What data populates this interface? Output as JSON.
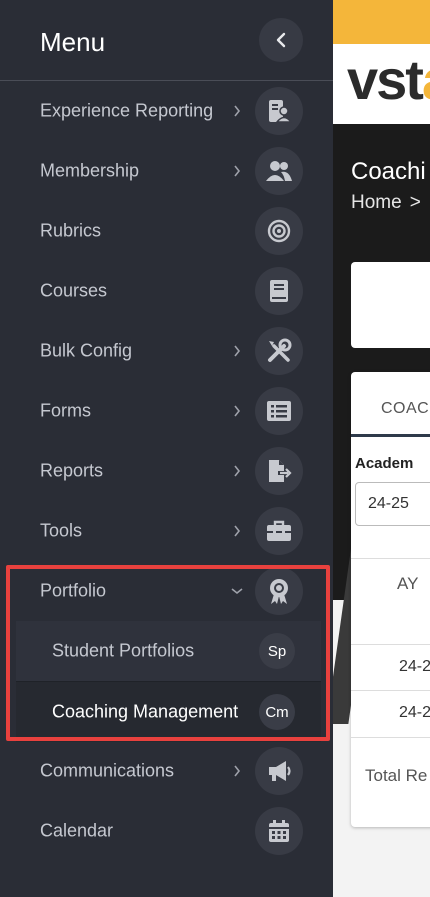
{
  "menu": {
    "title": "Menu",
    "collapse_icon": "chevron-left-icon",
    "items": [
      {
        "label": "Experience Reporting",
        "has_chevron": true,
        "icon": "person-id-card-icon"
      },
      {
        "label": "Membership",
        "has_chevron": true,
        "icon": "people-icon"
      },
      {
        "label": "Rubrics",
        "has_chevron": false,
        "icon": "target-icon"
      },
      {
        "label": "Courses",
        "has_chevron": false,
        "icon": "book-icon"
      },
      {
        "label": "Bulk Config",
        "has_chevron": true,
        "icon": "tools-icon"
      },
      {
        "label": "Forms",
        "has_chevron": true,
        "icon": "list-icon"
      },
      {
        "label": "Reports",
        "has_chevron": true,
        "icon": "file-export-icon"
      },
      {
        "label": "Tools",
        "has_chevron": true,
        "icon": "toolbox-icon"
      },
      {
        "label": "Portfolio",
        "expanded": true,
        "icon": "award-icon"
      },
      {
        "label": "Communications",
        "has_chevron": true,
        "icon": "megaphone-icon"
      },
      {
        "label": "Calendar",
        "has_chevron": false,
        "icon": "calendar-icon"
      }
    ],
    "portfolio_children": [
      {
        "label": "Student Portfolios",
        "badge": "Sp"
      },
      {
        "label": "Coaching Management",
        "badge": "Cm",
        "active": true
      }
    ]
  },
  "page": {
    "logo_text_1": "vst",
    "logo_text_2": "a",
    "title": "Coachi",
    "breadcrumb": {
      "home": "Home",
      "sep": ">"
    },
    "tab_label": "COACI",
    "field_label": "Academ",
    "field_value": "24-25",
    "table": {
      "header": "AY",
      "rows": [
        "24-2",
        "24-2"
      ],
      "total": "Total Re"
    }
  },
  "colors": {
    "sidebar_bg": "#2a2d36",
    "accent_yellow": "#f4b63a",
    "highlight_red": "#e8413e"
  }
}
